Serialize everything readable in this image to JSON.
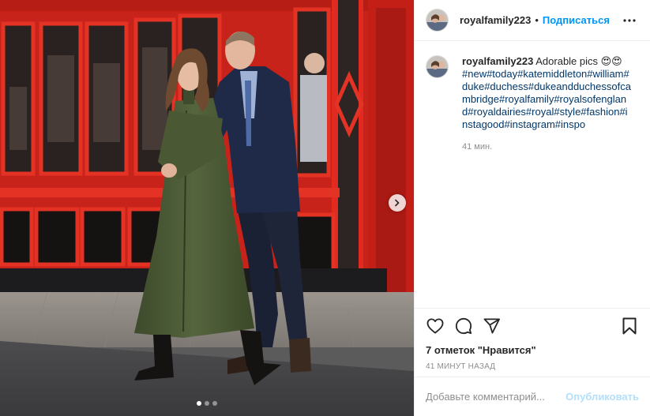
{
  "post": {
    "username": "royalfamily223",
    "separator": "•",
    "follow_label": "Подписаться",
    "caption": {
      "username": "royalfamily223",
      "text": "Adorable pics 😍😍",
      "hashtags": "#new#today#katemiddleton#william#duke#duchess#dukeandduchessofcambridge#royalfamily#royalsofengland#royaldairies#royal#style#fashion#instagood#instagram#inspo",
      "time": "41 мин."
    },
    "likes": "7 отметок \"Нравится\"",
    "posted_time": "41 МИНУТ НАЗАД",
    "comment_placeholder": "Добавьте комментарий...",
    "publish_label": "Опубликовать",
    "carousel": {
      "total": 3,
      "active": 0
    }
  },
  "icons": {
    "more": "more-horizontal-icon",
    "like": "heart-icon",
    "comment": "comment-icon",
    "share": "share-plane-icon",
    "save": "bookmark-icon",
    "next": "chevron-right-icon"
  },
  "colors": {
    "link_blue": "#0095f6",
    "hashtag": "#00376b",
    "muted": "#8e8e8e",
    "publish_disabled": "#b2dffc",
    "storefront_red": "#e0251b"
  }
}
